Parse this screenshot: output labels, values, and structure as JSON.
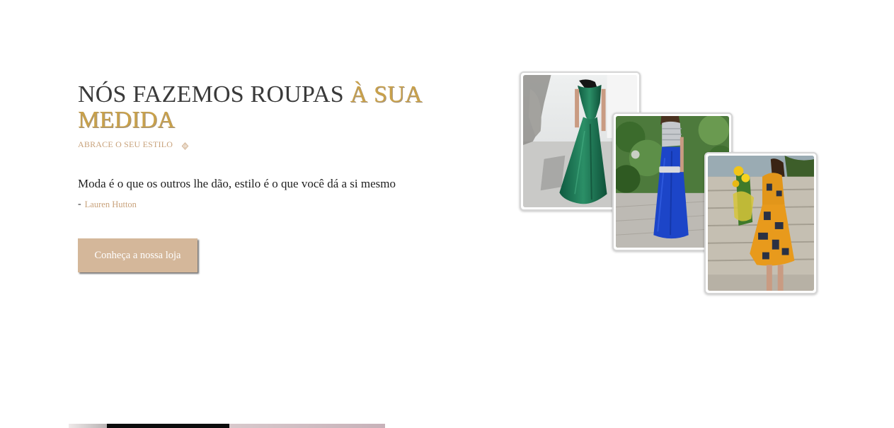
{
  "hero": {
    "title_main": "NÓS FAZEMOS ROUPAS",
    "title_accent": "À SUA MEDIDA",
    "subtitle": "ABRACE O SEU ESTILO",
    "quote": "Moda é o que os outros lhe dão, estilo é o que você dá a si mesmo",
    "author_dash": "-",
    "author": "Lauren Hutton",
    "cta_label": "Conheça a nossa loja"
  },
  "colors": {
    "accent_gold": "#c9a14a",
    "accent_tan": "#c8a27b",
    "button_bg": "#d4b79a",
    "title_text": "#3a3a3a"
  },
  "gallery": {
    "photos": [
      {
        "subject": "green-satin-gown"
      },
      {
        "subject": "blue-skirt-sequin-top"
      },
      {
        "subject": "orange-print-dress"
      }
    ]
  },
  "icons": {
    "subtitle_icon": "diamond-ornament-icon"
  }
}
